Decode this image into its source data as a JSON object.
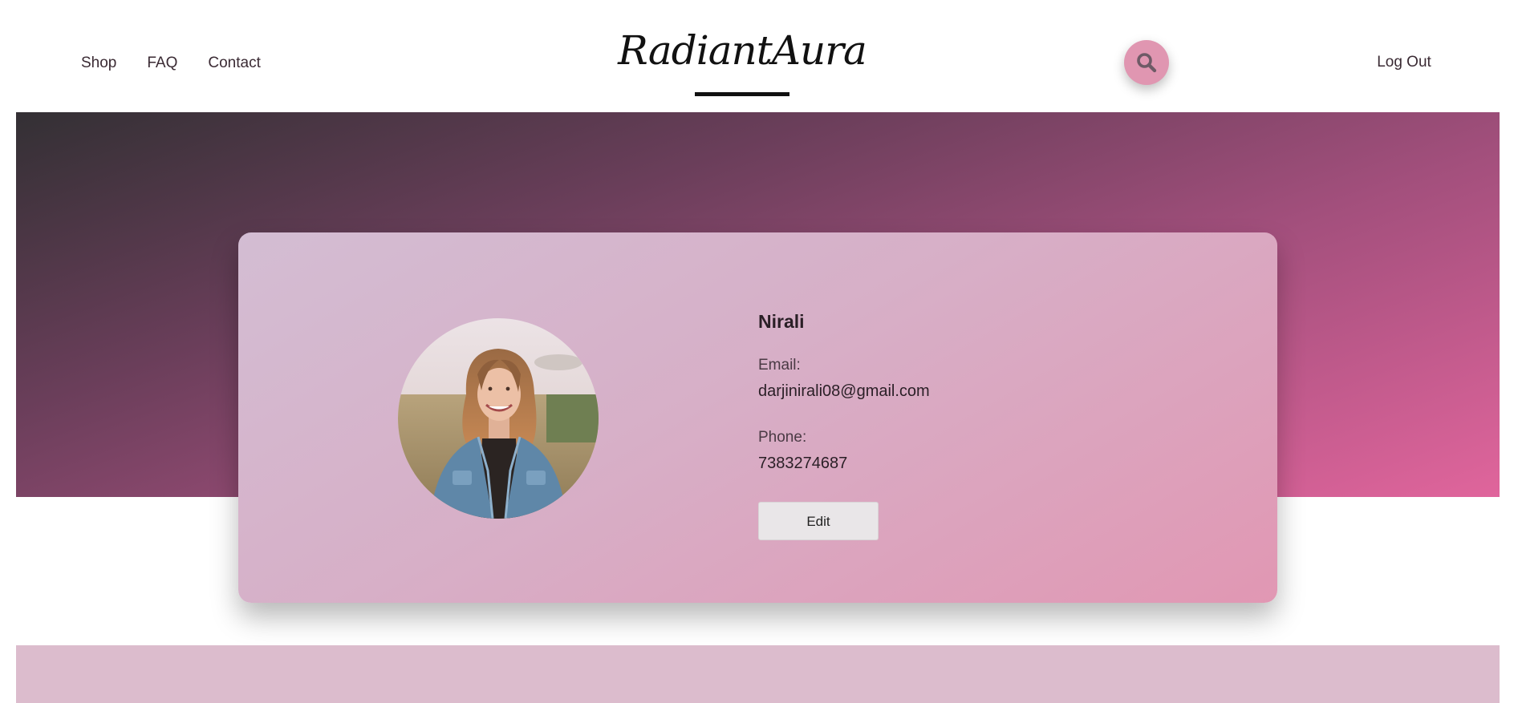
{
  "header": {
    "nav": [
      {
        "label": "Shop"
      },
      {
        "label": "FAQ"
      },
      {
        "label": "Contact"
      }
    ],
    "logo": "RadiantAura",
    "search_icon": "search-icon",
    "logout_label": "Log Out"
  },
  "profile": {
    "name": "Nirali",
    "email_label": "Email:",
    "email": "darjinirali08@gmail.com",
    "phone_label": "Phone:",
    "phone": "7383274687",
    "edit_label": "Edit"
  },
  "colors": {
    "accent_pink": "#e096b1",
    "hero_dark": "#333034",
    "hero_pink": "#e0659c",
    "card_light": "#d3bdd3",
    "card_pink": "#e197b3",
    "bottom_band": "#dcbccd"
  }
}
